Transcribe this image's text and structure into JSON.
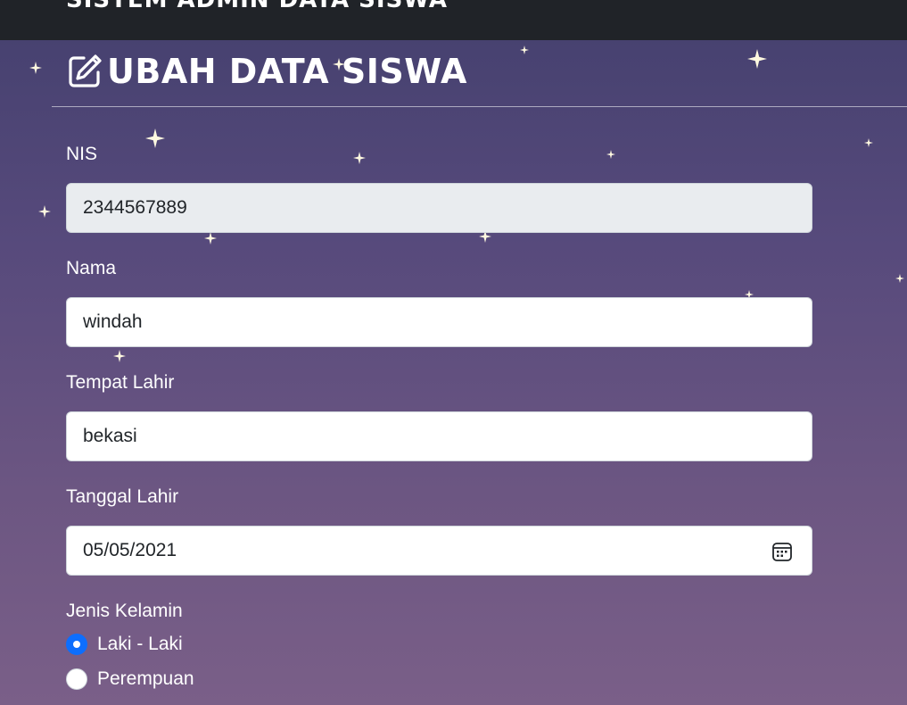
{
  "navbar": {
    "brand": "SISTEM ADMIN DATA SISWA"
  },
  "page": {
    "title": "UBAH DATA SISWA",
    "title_icon": "edit-square-icon"
  },
  "form": {
    "nis": {
      "label": "NIS",
      "value": "2344567889"
    },
    "nama": {
      "label": "Nama",
      "value": "windah"
    },
    "tempat_lahir": {
      "label": "Tempat Lahir",
      "value": "bekasi"
    },
    "tanggal_lahir": {
      "label": "Tanggal Lahir",
      "value": "05/05/2021",
      "icon": "calendar-icon"
    },
    "jenis_kelamin": {
      "label": "Jenis Kelamin",
      "options": [
        {
          "label": "Laki - Laki",
          "checked": true
        },
        {
          "label": "Perempuan",
          "checked": false
        }
      ]
    }
  },
  "colors": {
    "navbar_bg": "#202328",
    "background_top": "#44406e",
    "background_bottom": "#7a5f88",
    "radio_checked": "#0d6efd",
    "readonly_input_bg": "#e9ecef"
  }
}
